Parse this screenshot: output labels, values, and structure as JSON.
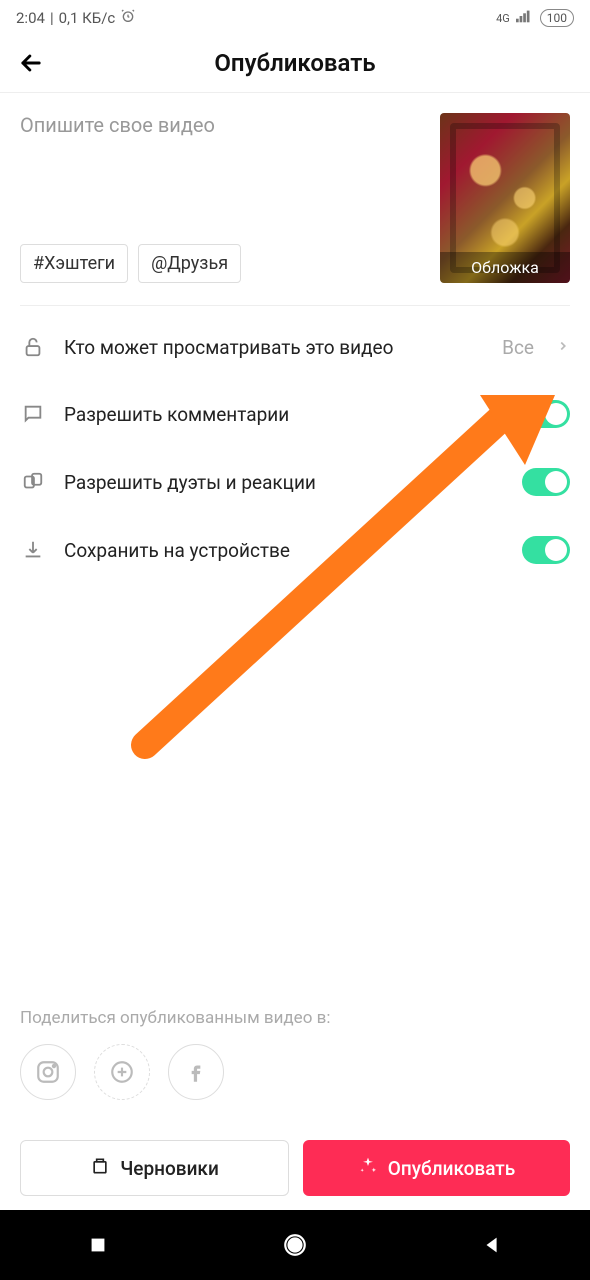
{
  "status": {
    "time": "2:04",
    "speed": "0,1 КБ/с",
    "network": "4G",
    "battery": "100"
  },
  "header": {
    "title": "Опубликовать"
  },
  "compose": {
    "placeholder": "Опишите свое видео",
    "hashtag_chip": "#Хэштеги",
    "friends_chip": "@Друзья",
    "cover_label": "Обложка"
  },
  "settings": {
    "privacy": {
      "label": "Кто может просматривать это видео",
      "value": "Все"
    },
    "comments": {
      "label": "Разрешить комментарии"
    },
    "duets": {
      "label": "Разрешить дуэты и реакции"
    },
    "save": {
      "label": "Сохранить на устройстве"
    }
  },
  "share": {
    "label": "Поделиться опубликованным видео в:"
  },
  "footer": {
    "drafts": "Черновики",
    "publish": "Опубликовать"
  }
}
